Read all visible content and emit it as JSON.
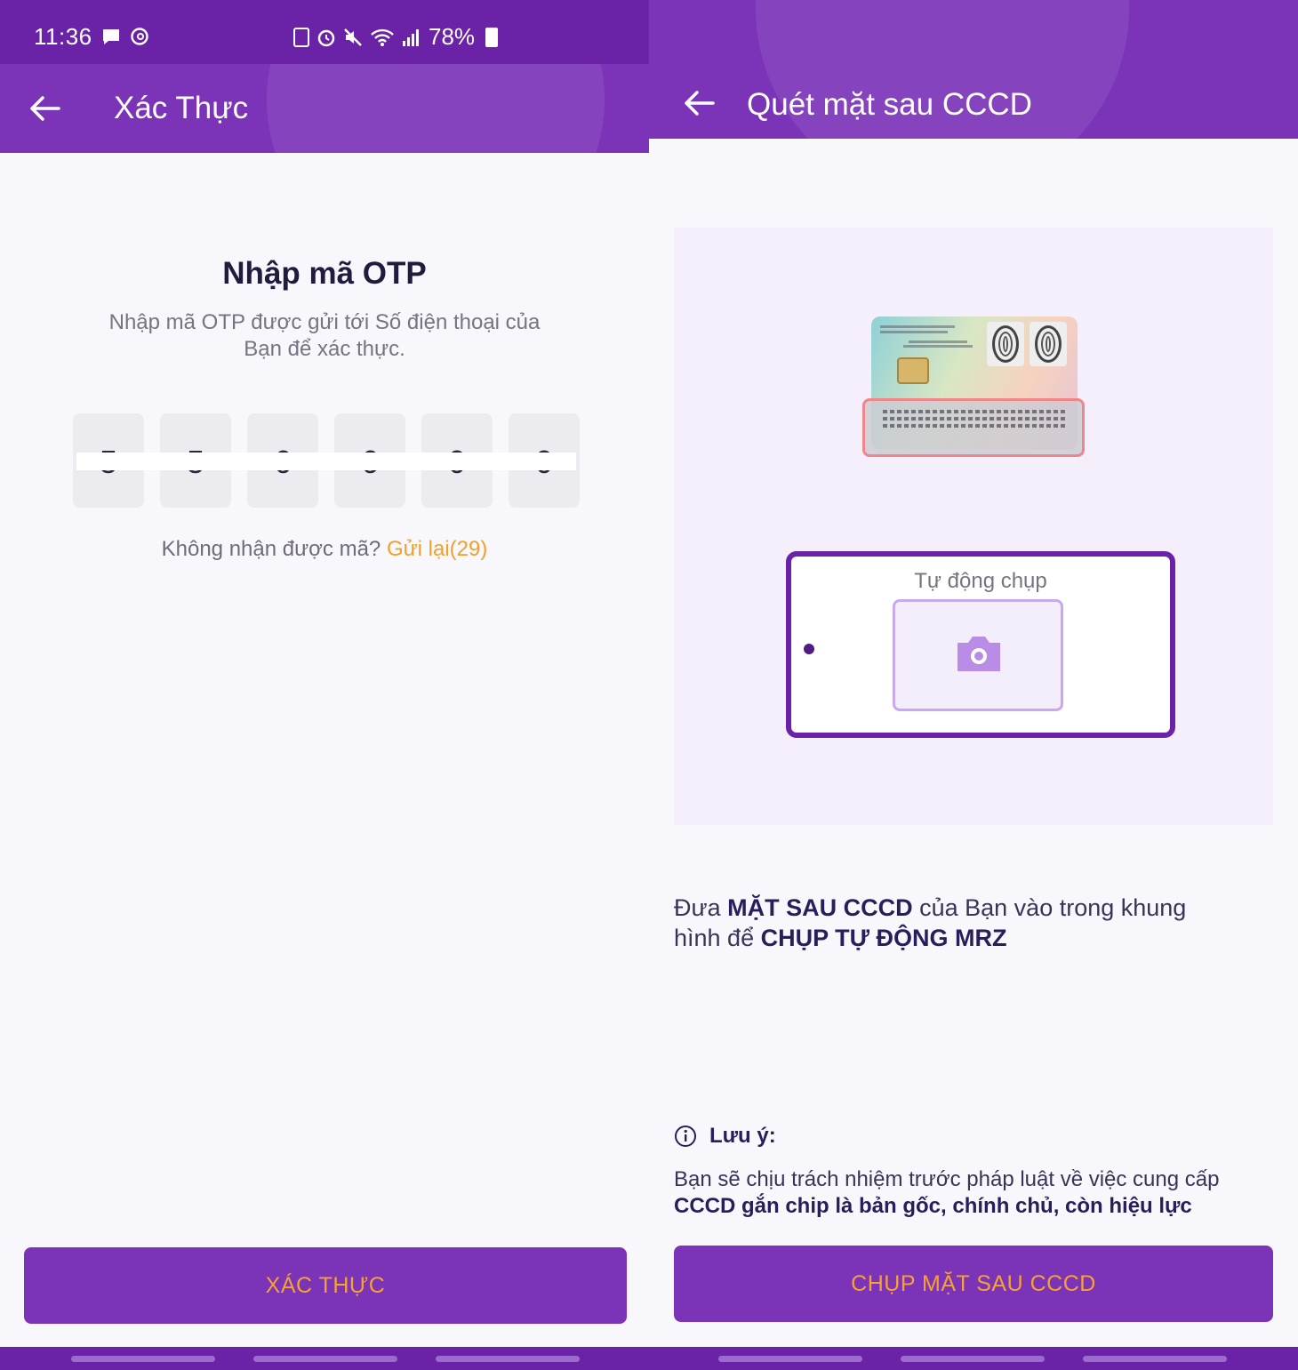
{
  "status_bar": {
    "time": "11:36",
    "battery": "78%"
  },
  "left_screen": {
    "title": "Xác Thực",
    "heading": "Nhập mã OTP",
    "description": "Nhập mã OTP được gửi tới Số điện thoại của Bạn để xác thực.",
    "otp_digits": [
      "5",
      "5",
      "6",
      "6",
      "0",
      "0"
    ],
    "resend_prompt": "Không nhận được mã?",
    "resend_link": "Gửi lại(29)",
    "submit_label": "XÁC THỰC"
  },
  "right_screen": {
    "title": "Quét mặt sau CCCD",
    "auto_capture_label": "Tự động chụp",
    "instruction": {
      "part1": "Đưa ",
      "bold1": "MẶT SAU CCCD",
      "part2": " của Bạn vào trong khung hình để ",
      "bold2": "CHỤP TỰ ĐỘNG MRZ"
    },
    "note_title": "Lưu ý:",
    "note": {
      "part1": "Bạn sẽ chịu trách nhiệm trước pháp luật về việc cung cấp ",
      "bold1": "CCCD gắn chip là bản gốc, chính chủ, còn hiệu lực"
    },
    "capture_label": "CHỤP MẶT SAU CCCD"
  },
  "colors": {
    "primary": "#7b33b8",
    "status_bar": "#6a22a6",
    "accent_text": "#f6a232",
    "link": "#f2a02b"
  },
  "icons": [
    "back-arrow-icon",
    "message-icon",
    "threads-icon",
    "alarm-icon",
    "mute-icon",
    "wifi-icon",
    "signal-icon",
    "battery-icon",
    "camera-icon",
    "info-icon"
  ]
}
